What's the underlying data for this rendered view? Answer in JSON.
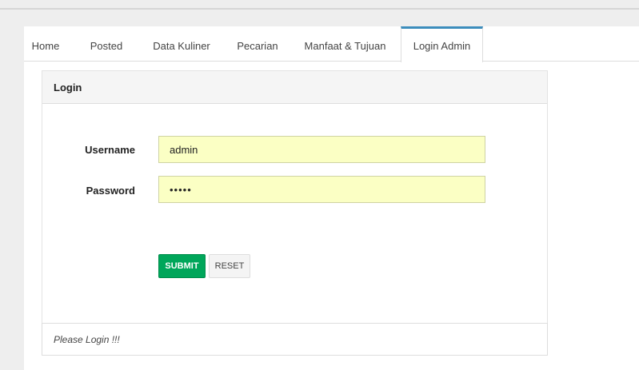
{
  "tabs": [
    {
      "label": "Home",
      "active": false
    },
    {
      "label": "Posted",
      "active": false
    },
    {
      "label": "Data Kuliner",
      "active": false
    },
    {
      "label": "Pecarian",
      "active": false
    },
    {
      "label": "Manfaat & Tujuan",
      "active": false
    },
    {
      "label": "Login Admin",
      "active": true
    }
  ],
  "login_box": {
    "title": "Login",
    "username_label": "Username",
    "username_value": "admin",
    "password_label": "Password",
    "password_value": "•••••",
    "submit_label": "SUBMIT",
    "reset_label": "RESET"
  },
  "footer": {
    "message": "Please Login !!!"
  },
  "colors": {
    "active_tab_accent": "#3c8dbc",
    "submit_button": "#00a65a",
    "input_background": "#fbffc4"
  }
}
